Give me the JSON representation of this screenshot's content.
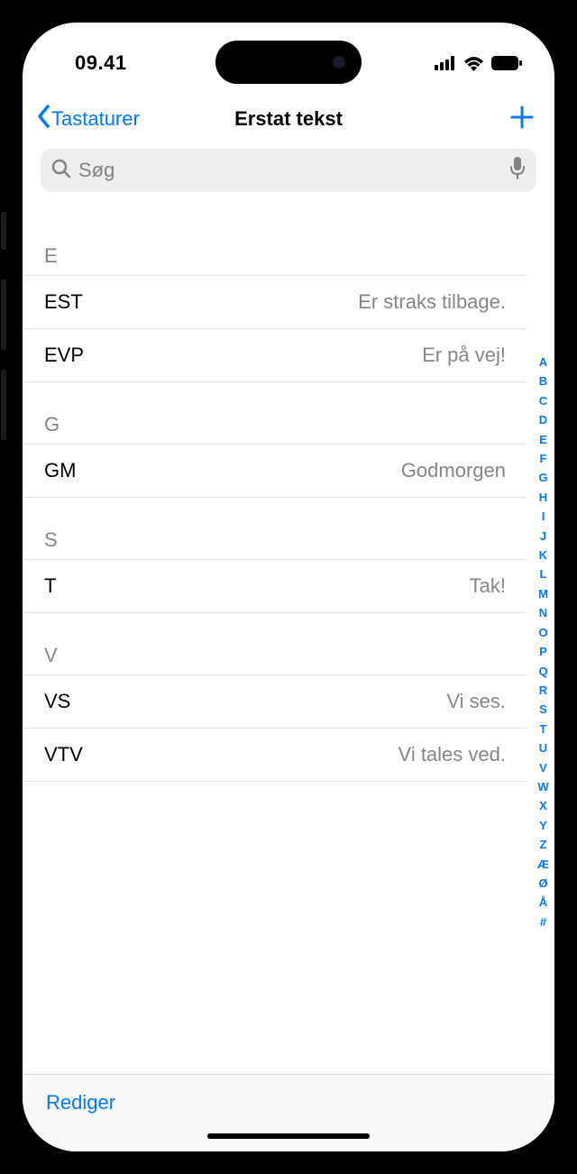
{
  "status": {
    "time": "09.41"
  },
  "nav": {
    "back_label": "Tastaturer",
    "title": "Erstat tekst"
  },
  "search": {
    "placeholder": "Søg"
  },
  "sections": [
    {
      "letter": "E",
      "rows": [
        {
          "shortcut": "EST",
          "phrase": "Er straks tilbage."
        },
        {
          "shortcut": "EVP",
          "phrase": "Er på vej!"
        }
      ]
    },
    {
      "letter": "G",
      "rows": [
        {
          "shortcut": "GM",
          "phrase": "Godmorgen"
        }
      ]
    },
    {
      "letter": "S",
      "rows": [
        {
          "shortcut": "T",
          "phrase": "Tak!"
        }
      ]
    },
    {
      "letter": "V",
      "rows": [
        {
          "shortcut": "VS",
          "phrase": "Vi ses."
        },
        {
          "shortcut": "VTV",
          "phrase": "Vi tales ved."
        }
      ]
    }
  ],
  "alpha_index": [
    "A",
    "B",
    "C",
    "D",
    "E",
    "F",
    "G",
    "H",
    "I",
    "J",
    "K",
    "L",
    "M",
    "N",
    "O",
    "P",
    "Q",
    "R",
    "S",
    "T",
    "U",
    "V",
    "W",
    "X",
    "Y",
    "Z",
    "Æ",
    "Ø",
    "Å",
    "#"
  ],
  "toolbar": {
    "edit_label": "Rediger"
  }
}
